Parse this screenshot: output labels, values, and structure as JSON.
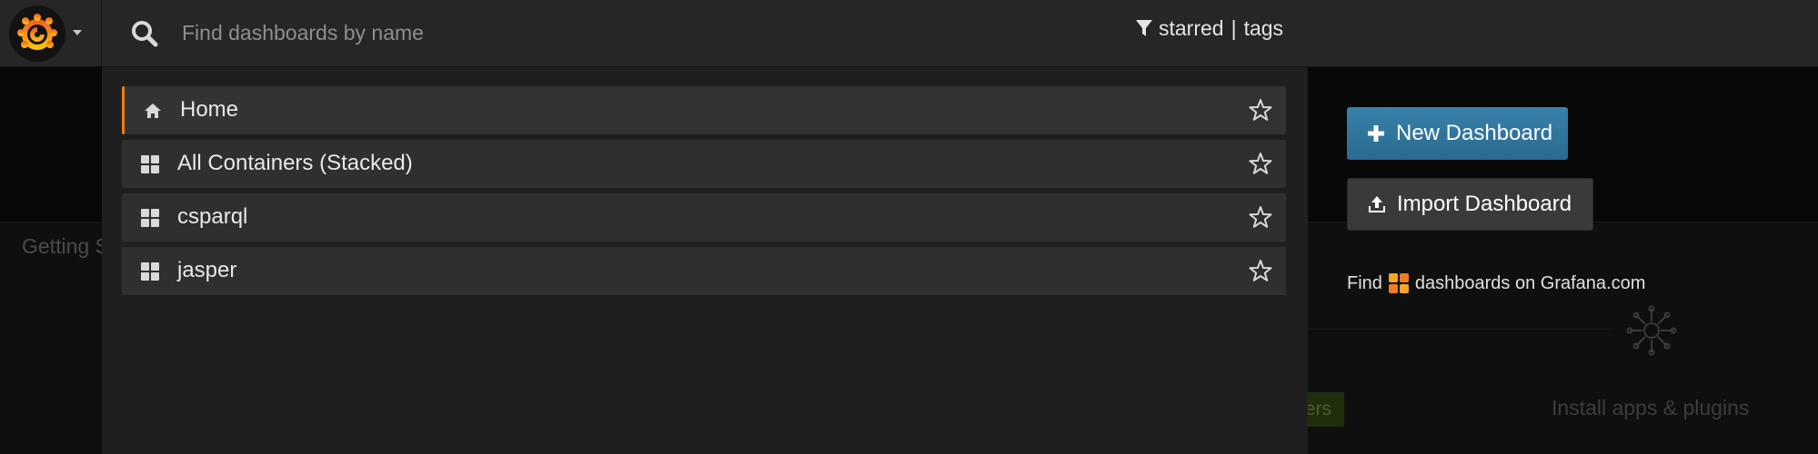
{
  "navbar": {
    "logo_icon": "grafana-logo-icon",
    "menu_caret_icon": "caret-down-icon",
    "search_icon": "search-icon",
    "search_placeholder": "Find dashboards by name",
    "search_value": "",
    "filter_icon": "filter-icon",
    "filter_starred": "starred",
    "filter_separator": "|",
    "filter_tags": "tags"
  },
  "results": [
    {
      "label": "Home",
      "icon": "home-icon",
      "active": true,
      "starred": false
    },
    {
      "label": "All Containers (Stacked)",
      "icon": "dashboard-grid-icon",
      "active": false,
      "starred": false
    },
    {
      "label": "csparql",
      "icon": "dashboard-grid-icon",
      "active": false,
      "starred": false
    },
    {
      "label": "jasper",
      "icon": "dashboard-grid-icon",
      "active": false,
      "starred": false
    }
  ],
  "actions": {
    "new_dashboard": "New Dashboard",
    "import_dashboard": "Import Dashboard",
    "find_prefix": "Find",
    "find_suffix": "dashboards on Grafana.com"
  },
  "background": {
    "getting_started": "Getting S",
    "green_badge": "ers",
    "install_plugins": "Install apps & plugins"
  },
  "colors": {
    "accent": "#eb7b18",
    "primary_button": "#31749d",
    "navbar": "#262626",
    "dropdown": "#1f1f20"
  }
}
